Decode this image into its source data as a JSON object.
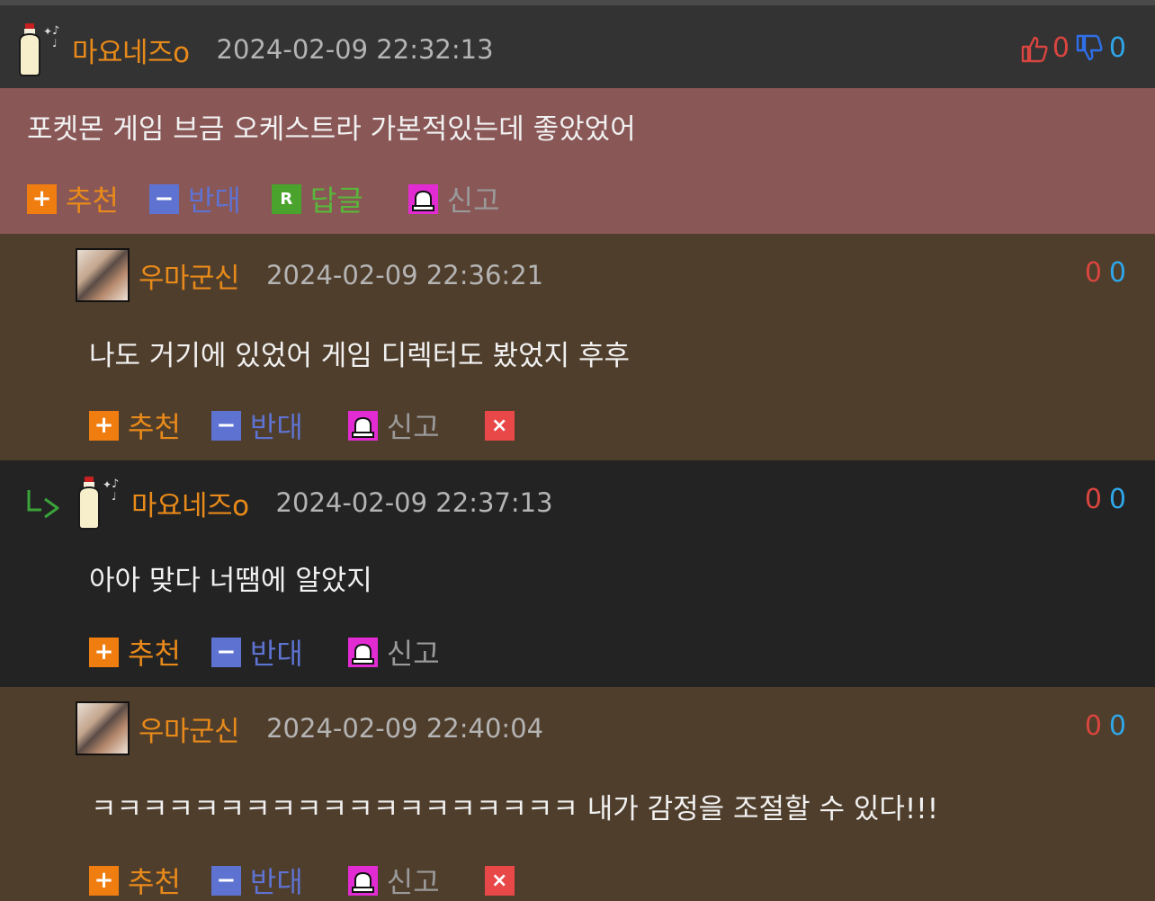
{
  "comments": [
    {
      "nick": "마요네즈o",
      "date": "2024-02-09 22:32:13",
      "content": "포켓몬 게임 브금 오케스트라 가본적있는데 좋았었어",
      "likes": "0",
      "dislikes": "0",
      "actions": {
        "recommend": "추천",
        "oppose": "반대",
        "reply": "답글",
        "report": "신고"
      }
    },
    {
      "nick": "우마군신",
      "date": "2024-02-09 22:36:21",
      "content": "나도 거기에 있었어 게임 디렉터도 봤었지 후후",
      "likes": "0",
      "dislikes": "0",
      "actions": {
        "recommend": "추천",
        "oppose": "반대",
        "report": "신고"
      }
    },
    {
      "nick": "마요네즈o",
      "date": "2024-02-09 22:37:13",
      "content": "아아 맞다 너땜에 알았지",
      "likes": "0",
      "dislikes": "0",
      "actions": {
        "recommend": "추천",
        "oppose": "반대",
        "report": "신고"
      }
    },
    {
      "nick": "우마군신",
      "date": "2024-02-09 22:40:04",
      "content": "ㅋㅋㅋㅋㅋㅋㅋㅋㅋㅋㅋㅋㅋㅋㅋㅋㅋㅋㅋ 내가 감정을 조절할 수 있다!!!",
      "likes": "0",
      "dislikes": "0",
      "actions": {
        "recommend": "추천",
        "oppose": "반대",
        "report": "신고"
      }
    }
  ],
  "icons": {
    "plus": "+",
    "minus": "−",
    "reply": "R",
    "delete": "×",
    "thumbs_up": "thumbs-up-icon",
    "thumbs_down": "thumbs-down-icon",
    "siren": "siren-icon",
    "reply_arrow": "reply-arrow-icon"
  },
  "colors": {
    "nick": "#e88a1a",
    "recommend": "#ef7d10",
    "oppose": "#5e73d1",
    "reply": "#4aa32c",
    "report_icon": "#e22bd2",
    "like": "#d9453f",
    "dislike": "#2fa6e8"
  }
}
